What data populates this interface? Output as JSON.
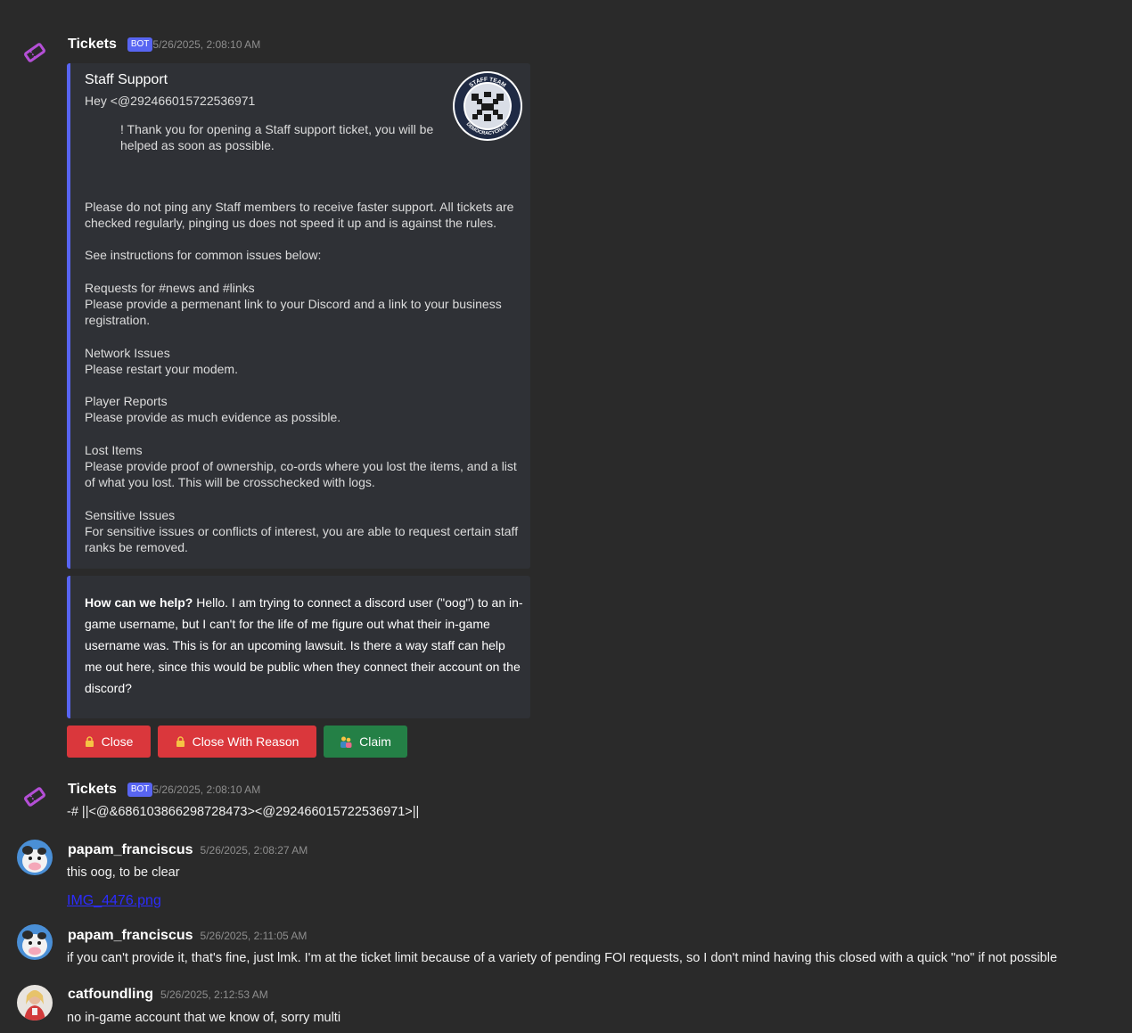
{
  "messages": [
    {
      "author": "Tickets",
      "bot_tag": "BOT",
      "timestamp": "5/26/2025, 2:08:10 AM",
      "embed": {
        "title": "Staff Support",
        "lines": [
          "Hey <@292466015722536971",
          "! Thank you for opening a Staff support ticket, you will be",
          "helped as soon as possible.",
          "Please do not ping any Staff members to receive faster support. All tickets are",
          "checked regularly, pinging us does not speed it up and is against the rules.",
          "See instructions for common issues below:",
          "Requests for #news and #links",
          "Please provide a permenant link to your Discord and a link to your business",
          "registration.",
          "Network Issues",
          "Please restart your modem.",
          "Player Reports",
          "Please provide as much evidence as possible.",
          "Lost Items",
          "Please provide proof of ownership, co-ords where you lost the items, and a list",
          "of what you lost. This will be crosschecked with logs.",
          "Sensitive Issues",
          "For sensitive issues or conflicts of interest, you are able to request certain staff",
          "ranks be removed."
        ],
        "thumbnail_text_top": "STAFF TEAM",
        "thumbnail_text_bottom": "DEMOCRACYCRAFT"
      },
      "question_embed": {
        "label": "How can we help?",
        "body": "Hello. I am trying to connect a discord user (\"oog\") to an in-game username, but I can't for the life of me figure out what their in-game username was. This is for an upcoming lawsuit. Is there a way staff can help me out here, since this would be public when they connect their account on the discord?"
      },
      "buttons": [
        {
          "label": "Close",
          "icon": "lock-icon",
          "color": "#da373c"
        },
        {
          "label": "Close With Reason",
          "icon": "lock-icon",
          "color": "#da373c"
        },
        {
          "label": "Claim",
          "icon": "people-icon",
          "color": "#248046"
        }
      ]
    },
    {
      "author": "Tickets",
      "bot_tag": "BOT",
      "timestamp": "5/26/2025, 2:08:10 AM",
      "text": "-# ||<@&686103866298728473><@292466015722536971>||"
    },
    {
      "author": "papam_franciscus",
      "timestamp": "5/26/2025, 2:08:27 AM",
      "text": "this oog, to be clear",
      "attachment": "IMG_4476.png"
    },
    {
      "author": "papam_franciscus",
      "timestamp": "5/26/2025, 2:11:05 AM",
      "text": "if you can't provide it, that's fine, just lmk. I'm at the ticket limit because of a variety of pending FOI requests, so I don't mind having this closed with a quick \"no\" if not possible"
    },
    {
      "author": "catfoundling",
      "timestamp": "5/26/2025, 2:12:53 AM",
      "text": "no in-game account that we know of, sorry multi"
    }
  ],
  "colors": {
    "background": "#2a2a2a",
    "embed_bg": "#2f3136",
    "embed_border": "#5865f2",
    "bot_tag": "#5865f2",
    "danger": "#da373c",
    "success": "#248046",
    "ticket_icon": "#b44fd6",
    "link": "#2c2cff"
  }
}
